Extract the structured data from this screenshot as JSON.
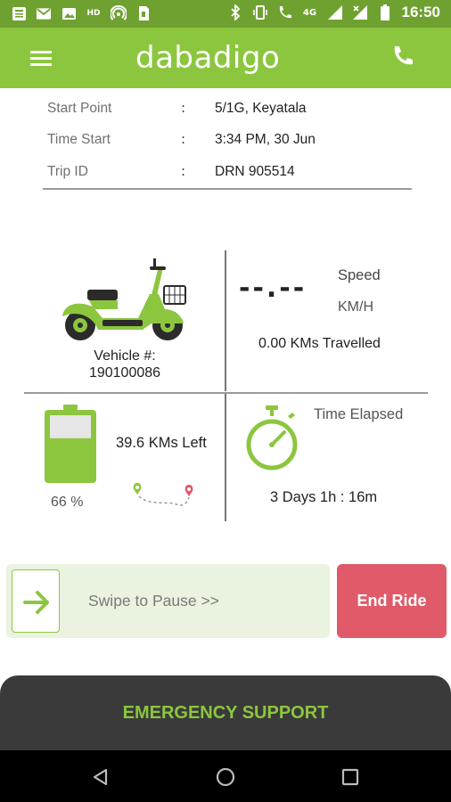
{
  "status_bar": {
    "time": "16:50",
    "left_icons": [
      "news-icon",
      "mail-icon",
      "image-icon",
      "hd-icon",
      "hotspot-icon",
      "sim-icon"
    ],
    "right_icons": [
      "bluetooth-icon",
      "vibrate-icon",
      "wifi-call-icon",
      "4g-signal-icon",
      "signal-icon",
      "signal-x-icon",
      "battery-icon"
    ],
    "hd_label": "HD",
    "lte_label": "4G"
  },
  "app_bar": {
    "logo_text": "dabadigo",
    "menu_icon": "hamburger-menu-icon",
    "call_icon": "phone-icon"
  },
  "trip": {
    "rows": [
      {
        "label": "Start Point",
        "colon": ":",
        "value": "5/1G, Keyatala"
      },
      {
        "label": "Time Start",
        "colon": ":",
        "value": "3:34 PM, 30 Jun"
      },
      {
        "label": "Trip ID",
        "colon": ":",
        "value": "DRN 905514"
      }
    ]
  },
  "vehicle": {
    "label": "Vehicle #:",
    "number": "190100086",
    "icon": "scooter-icon"
  },
  "speed": {
    "value": "--.--",
    "label": "Speed",
    "unit": "KM/H",
    "travelled": "0.00 KMs Travelled"
  },
  "battery": {
    "percent_text": "66 %",
    "level": 0.66,
    "kms_left": "39.6 KMs Left",
    "icon": "battery-icon",
    "route_icon": "route-icon"
  },
  "time_elapsed": {
    "label": "Time Elapsed",
    "value": "3 Days 1h : 16m",
    "icon": "stopwatch-icon"
  },
  "swipe": {
    "text": "Swipe to Pause >>",
    "icon": "arrow-right-icon"
  },
  "end_ride": {
    "label": "End Ride"
  },
  "emergency": {
    "label": "EMERGENCY SUPPORT"
  },
  "nav": {
    "icons": [
      "back-icon",
      "home-icon",
      "recents-icon"
    ]
  },
  "colors": {
    "status_bar": "#6fa131",
    "brand_green": "#8cc63f",
    "end_ride": "#e05a6a",
    "emergency_bg": "#3a3a3a",
    "swipe_bg": "#e9f3df"
  }
}
